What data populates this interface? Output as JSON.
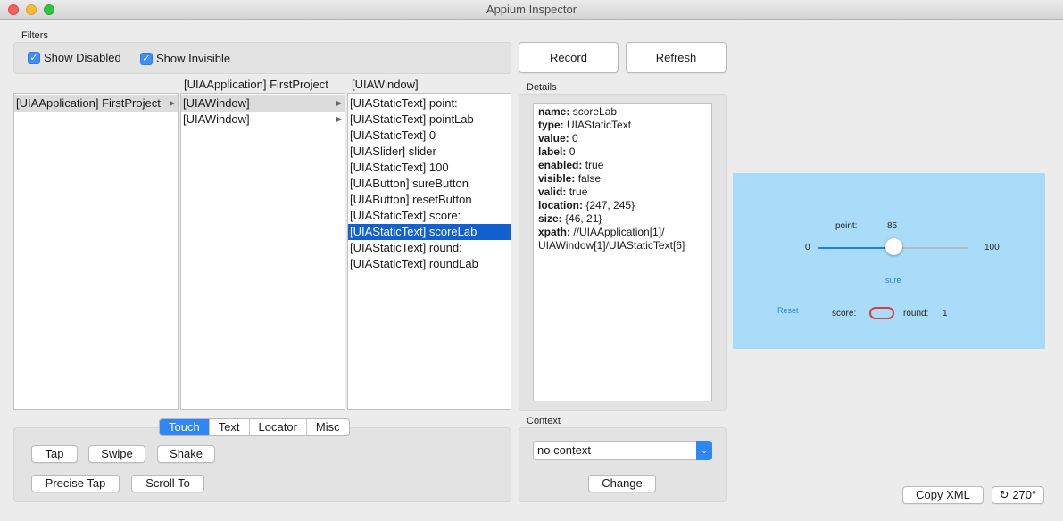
{
  "window": {
    "title": "Appium Inspector"
  },
  "filters": {
    "label": "Filters",
    "show_disabled": "Show Disabled",
    "show_invisible": "Show Invisible"
  },
  "buttons": {
    "record": "Record",
    "refresh": "Refresh"
  },
  "browser": {
    "col2_header": "[UIAApplication] FirstProject",
    "col3_header": "[UIAWindow]",
    "col1": [
      "[UIAApplication] FirstProject"
    ],
    "col2": [
      "[UIAWindow]",
      "[UIAWindow]"
    ],
    "col3": [
      "[UIAStaticText] point:",
      "[UIAStaticText] pointLab",
      "[UIAStaticText] 0",
      "[UIASlider] slider",
      "[UIAStaticText] 100",
      "[UIAButton] sureButton",
      "[UIAButton] resetButton",
      "[UIAStaticText] score:",
      "[UIAStaticText] scoreLab",
      "[UIAStaticText] round:",
      "[UIAStaticText] roundLab"
    ]
  },
  "details": {
    "label": "Details",
    "name_k": "name:",
    "name_v": "scoreLab",
    "type_k": "type:",
    "type_v": "UIAStaticText",
    "value_k": "value:",
    "value_v": "0",
    "label_k": "label:",
    "label_v": "0",
    "enabled_k": "enabled:",
    "enabled_v": "true",
    "visible_k": "visible:",
    "visible_v": "false",
    "valid_k": "valid:",
    "valid_v": "true",
    "location_k": "location:",
    "location_v": "{247, 245}",
    "size_k": "size:",
    "size_v": "{46, 21}",
    "xpath_k": "xpath:",
    "xpath_v1": "//UIAApplication[1]/",
    "xpath_v2": "UIAWindow[1]/UIAStaticText[6]"
  },
  "tabs": [
    "Touch",
    "Text",
    "Locator",
    "Misc"
  ],
  "actions": {
    "tap": "Tap",
    "swipe": "Swipe",
    "shake": "Shake",
    "precise_tap": "Precise Tap",
    "scroll_to": "Scroll To"
  },
  "context": {
    "label": "Context",
    "value": "no context",
    "change": "Change"
  },
  "footer": {
    "copy_xml": "Copy XML",
    "rotate": "270°"
  },
  "device": {
    "point_label": "point:",
    "point_value": "85",
    "min": "0",
    "max": "100",
    "slider_fraction": 0.5,
    "sure": "sure",
    "reset": "Reset",
    "score_label": "score:",
    "round_label": "round:",
    "round_value": "1"
  }
}
